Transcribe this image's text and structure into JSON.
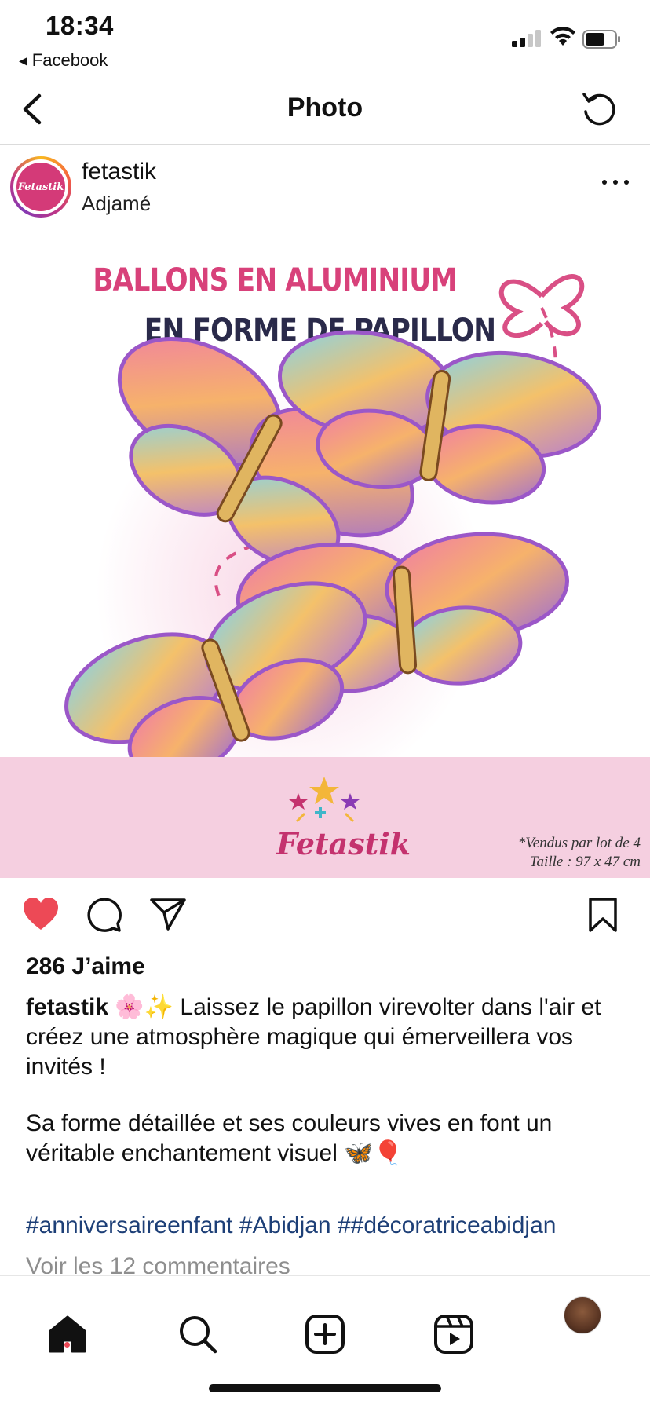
{
  "status_bar": {
    "time": "18:34",
    "back_app": "Facebook"
  },
  "header": {
    "title": "Photo"
  },
  "post": {
    "username": "fetastik",
    "location": "Adjamé",
    "avatar_text": "Fetastik",
    "image": {
      "headline_1": "BALLONS EN ALUMINIUM",
      "headline_2": "EN FORME DE PAPILLON",
      "brand": "Fetastik",
      "note_1": "*Vendus par lot de 4",
      "note_2": "Taille : 97 x 47 cm"
    },
    "likes": "286 J’aime",
    "caption_user": "fetastik",
    "caption_line1": "🌸✨ Laissez le papillon virevolter dans l'air et créez une atmosphère magique qui émerveillera vos invités !",
    "caption_line2": "Sa forme détaillée et ses couleurs vives en font un véritable enchantement visuel 🦋🎈",
    "hashtags": "#anniversaireenfant #Abidjan ##décoratriceabidjan",
    "comments_link": "Voir les 12 commentaires"
  },
  "icons": {
    "back": "chevron-left-icon",
    "refresh": "refresh-icon",
    "more": "more-horizontal-icon",
    "like": "heart-filled-icon",
    "comment": "comment-icon",
    "share": "send-icon",
    "save": "bookmark-icon",
    "nav": [
      "home-icon",
      "search-icon",
      "create-icon",
      "reels-icon",
      "profile-avatar"
    ]
  },
  "colors": {
    "like": "#ed4956",
    "hashtag": "#1d3f77",
    "band": "#f5cfe0",
    "headline_pink": "#d8417a"
  }
}
